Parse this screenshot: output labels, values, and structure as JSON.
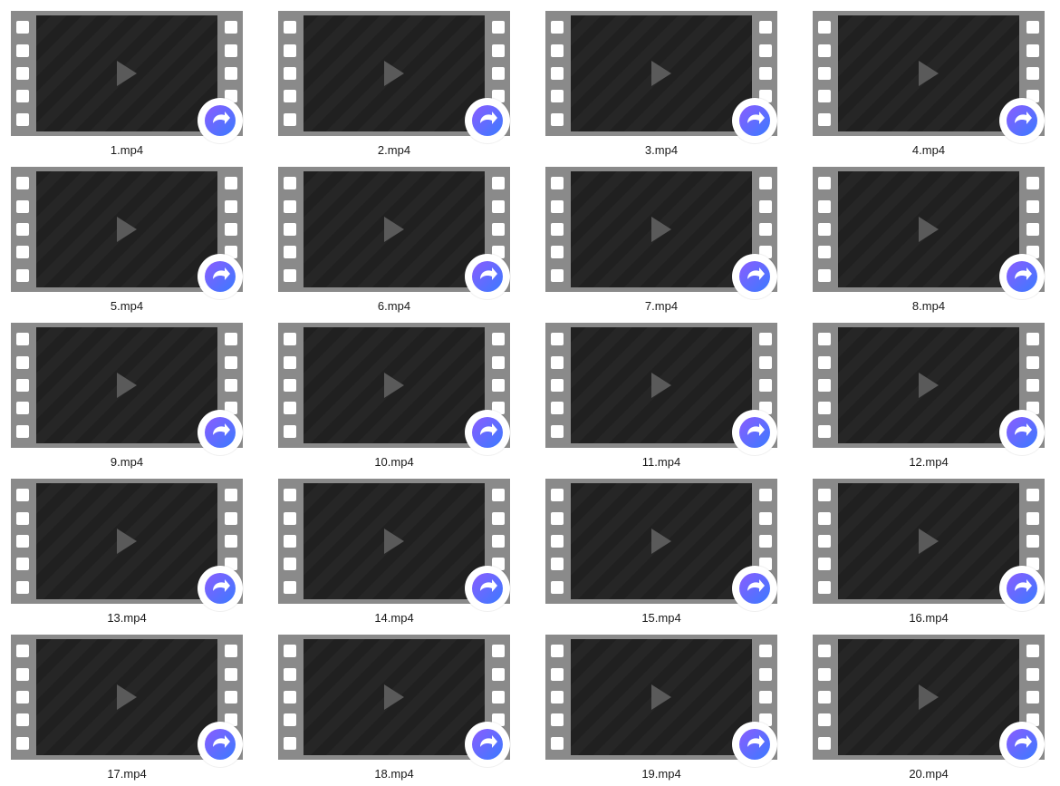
{
  "files": [
    {
      "name": "1.mp4"
    },
    {
      "name": "2.mp4"
    },
    {
      "name": "3.mp4"
    },
    {
      "name": "4.mp4"
    },
    {
      "name": "5.mp4"
    },
    {
      "name": "6.mp4"
    },
    {
      "name": "7.mp4"
    },
    {
      "name": "8.mp4"
    },
    {
      "name": "9.mp4"
    },
    {
      "name": "10.mp4"
    },
    {
      "name": "11.mp4"
    },
    {
      "name": "12.mp4"
    },
    {
      "name": "13.mp4"
    },
    {
      "name": "14.mp4"
    },
    {
      "name": "15.mp4"
    },
    {
      "name": "16.mp4"
    },
    {
      "name": "17.mp4"
    },
    {
      "name": "18.mp4"
    },
    {
      "name": "19.mp4"
    },
    {
      "name": "20.mp4"
    }
  ],
  "thumbnail": {
    "type": "video-file",
    "badge_icon": "share-arrow-icon",
    "accent": "#3a7bff",
    "accent_secondary": "#8a5cff",
    "filmstrip_color": "#8a8a8a"
  }
}
